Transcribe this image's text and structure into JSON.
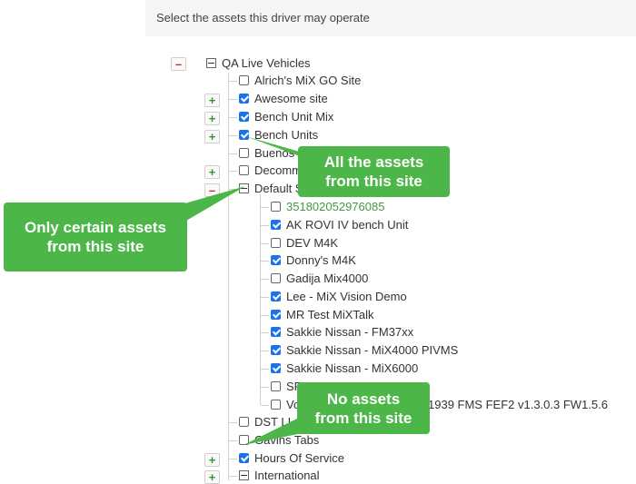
{
  "header": {
    "title": "Select the assets this driver may operate"
  },
  "tree": {
    "root": {
      "label": "QA Live Vehicles"
    },
    "sites": [
      {
        "label": "Alrich's MiX GO Site",
        "checked": false
      },
      {
        "label": "Awesome site",
        "checked": true
      },
      {
        "label": "Bench Unit Mix",
        "checked": true
      },
      {
        "label": "Bench Units",
        "checked": true
      },
      {
        "label": "Buenos",
        "checked": false
      },
      {
        "label": "Decomm",
        "checked": false
      },
      {
        "label": "Default S",
        "checked": false
      }
    ],
    "default_assets": [
      {
        "label": "351802052976085",
        "checked": false
      },
      {
        "label": "AK ROVI IV bench Unit",
        "checked": true
      },
      {
        "label": "DEV M4K",
        "checked": false
      },
      {
        "label": "Donny's M4K",
        "checked": true
      },
      {
        "label": "Gadija Mix4000",
        "checked": false
      },
      {
        "label": "Lee - MiX Vision Demo",
        "checked": true
      },
      {
        "label": "MR Test MiXTalk",
        "checked": true
      },
      {
        "label": "Sakkie Nissan - FM37xx",
        "checked": true
      },
      {
        "label": "Sakkie Nissan - MiX4000 PIVMS",
        "checked": true
      },
      {
        "label": "Sakkie Nissan - MiX6000",
        "checked": true
      },
      {
        "label": "SR",
        "checked": false
      },
      {
        "label": "Vo",
        "checked": false
      }
    ],
    "vo_tail": "1939 FMS FEF2 v1.3.0.3 FW1.5.6",
    "more_sites": [
      {
        "label": "DST LI",
        "checked": false
      },
      {
        "label": "Gavins Tabs",
        "checked": false
      },
      {
        "label": "Hours Of Service",
        "checked": true
      },
      {
        "label": "International",
        "checked": false
      }
    ]
  },
  "callouts": {
    "all": [
      "All the assets",
      "from this site"
    ],
    "certain": [
      "Only certain assets",
      "from this site"
    ],
    "none": [
      "No assets",
      "from this site"
    ]
  },
  "colors": {
    "callout": "#4cb648",
    "check": "#1a73e8",
    "plus": "#2e9a2e",
    "minus": "#dd2222"
  }
}
